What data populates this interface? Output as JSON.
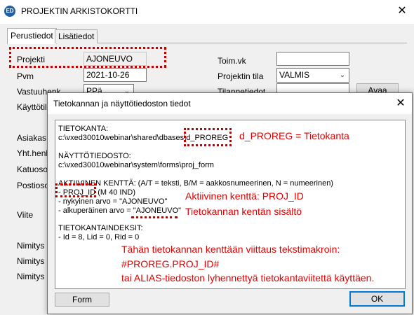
{
  "window": {
    "title": "PROJEKTIN ARKISTOKORTTI",
    "app_icon": "ED",
    "close_glyph": "✕"
  },
  "tabs": [
    "Perustiedot",
    "Lisätiedot"
  ],
  "form": {
    "projekti_label": "Projekti",
    "projekti_value": "AJONEUVO",
    "pvm_label": "Pvm",
    "pvm_value": "2021-10-26",
    "vastuuhenk_label": "Vastuuhenk",
    "vastuuhenk_value": "PPä",
    "kayttotila_label": "Käyttötila",
    "toimvk_label": "Toim.vk",
    "toimvk_value": "",
    "projektin_tila_label": "Projektin tila",
    "projektin_tila_value": "VALMIS",
    "tilannetiedot_label": "Tilannetiedot",
    "avaa_label": "Avaa",
    "asiakas_label": "Asiakas",
    "yhthenk_label": "Yht.henki",
    "katuosoite_label": "Katuosoi",
    "postiosoite_label": "Postiosoi",
    "viite_label": "Viite",
    "nimitys1_label": "Nimitys 1",
    "nimitys2_label": "Nimitys 2",
    "nimitys3_label": "Nimitys 3"
  },
  "dialog": {
    "title": "Tietokannan ja näyttötiedoston tiedot",
    "close_glyph": "✕",
    "lines": {
      "l1": "TIETOKANTA:",
      "l2a": "c:\\vxed30010webinar\\shared\\dbases\\",
      "l2b": "d_PROREG",
      "l3": "NÄYTTÖTIEDOSTO:",
      "l4": "c:\\vxed30010webinar\\system\\forms\\proj_form",
      "l5": "AKTIIVINEN KENTTÄ: (A/T = teksti, B/M = aakkosnumeerinen, N = numeerinen)",
      "l6a": "- PROJ_ID",
      "l6b": " (M 40 IND)",
      "l7": "- nykyinen arvo = \"AJONEUVO\"",
      "l8a": "- alkuperäinen arvo = ",
      "l8b": "\"AJONEUVO\"",
      "l9": "TIETOKANTAINDEKSIT:",
      "l10": "- Id = 8, Lid = 0, Rid = 0"
    },
    "annotations": {
      "a1": "d_PROREG = Tietokanta",
      "a2": "Aktiivinen kenttä: PROJ_ID",
      "a3": "Tietokannan kentän sisältö",
      "a4": "Tähän tietokannan kenttään viittaus tekstimakroin:",
      "a5": "#PROREG.PROJ_ID#",
      "a6": "tai ALIAS-tiedoston lyhennettyä tietokantaviitettä käyttäen."
    },
    "form_button": "Form",
    "ok_button": "OK"
  },
  "colors": {
    "annotation": "#e00000",
    "accent_blue": "#0078d7"
  }
}
